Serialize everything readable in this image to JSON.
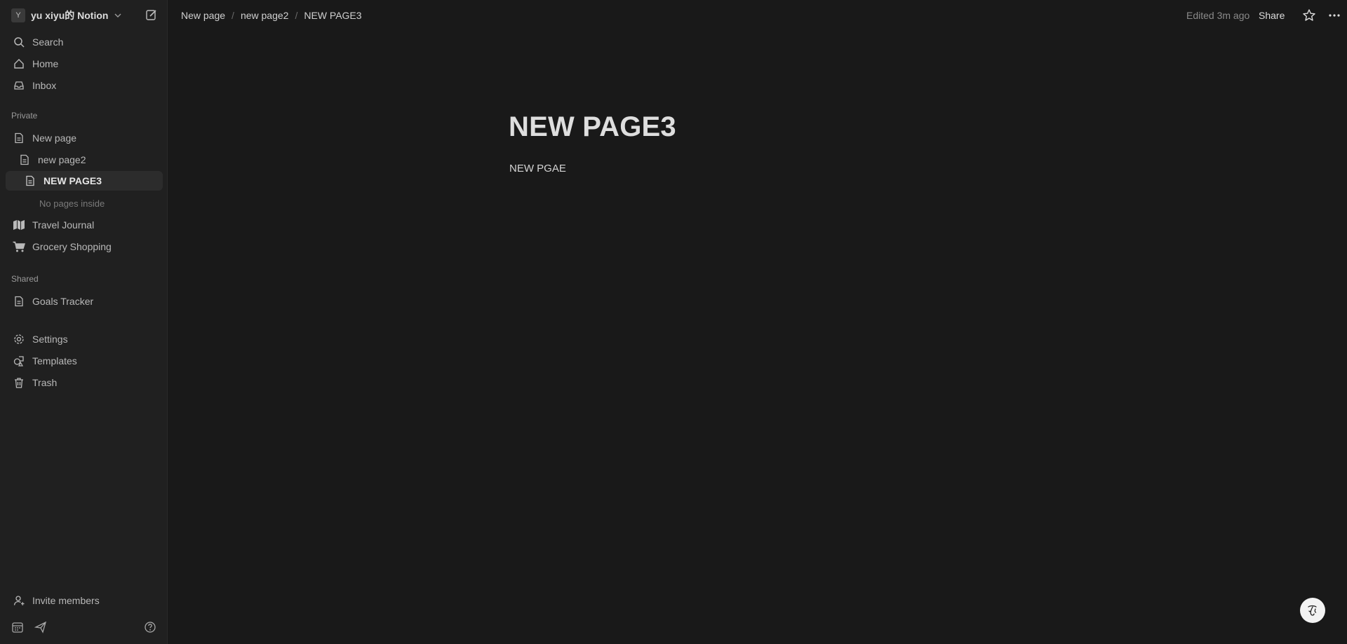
{
  "workspace": {
    "avatar_letter": "Y",
    "name": "yu xiyu的 Notion"
  },
  "sidebar": {
    "top_items": [
      {
        "label": "Search",
        "icon": "search-icon"
      },
      {
        "label": "Home",
        "icon": "home-icon"
      },
      {
        "label": "Inbox",
        "icon": "inbox-icon"
      }
    ],
    "private_label": "Private",
    "private_pages": [
      {
        "label": "New page",
        "icon": "page-icon"
      },
      {
        "label": "new page2",
        "icon": "page-icon"
      },
      {
        "label": "NEW PAGE3",
        "icon": "page-icon",
        "active": true
      }
    ],
    "no_pages_inside": "No pages inside",
    "private_more": [
      {
        "label": "Travel Journal",
        "icon": "map-icon"
      },
      {
        "label": "Grocery Shopping",
        "icon": "cart-icon"
      }
    ],
    "shared_label": "Shared",
    "shared_pages": [
      {
        "label": "Goals Tracker",
        "icon": "page-icon"
      }
    ],
    "utility": [
      {
        "label": "Settings",
        "icon": "gear-icon"
      },
      {
        "label": "Templates",
        "icon": "templates-icon"
      },
      {
        "label": "Trash",
        "icon": "trash-icon"
      }
    ],
    "invite_label": "Invite members"
  },
  "topbar": {
    "breadcrumbs": [
      "New page",
      "new page2",
      "NEW PAGE3"
    ],
    "separator": "/",
    "edited": "Edited 3m ago",
    "share_label": "Share"
  },
  "page": {
    "title": "NEW PAGE3",
    "body": "NEW PGAE"
  },
  "colors": {
    "background": "#191919",
    "sidebar": "#202020",
    "active_item": "#2c2c2c"
  }
}
